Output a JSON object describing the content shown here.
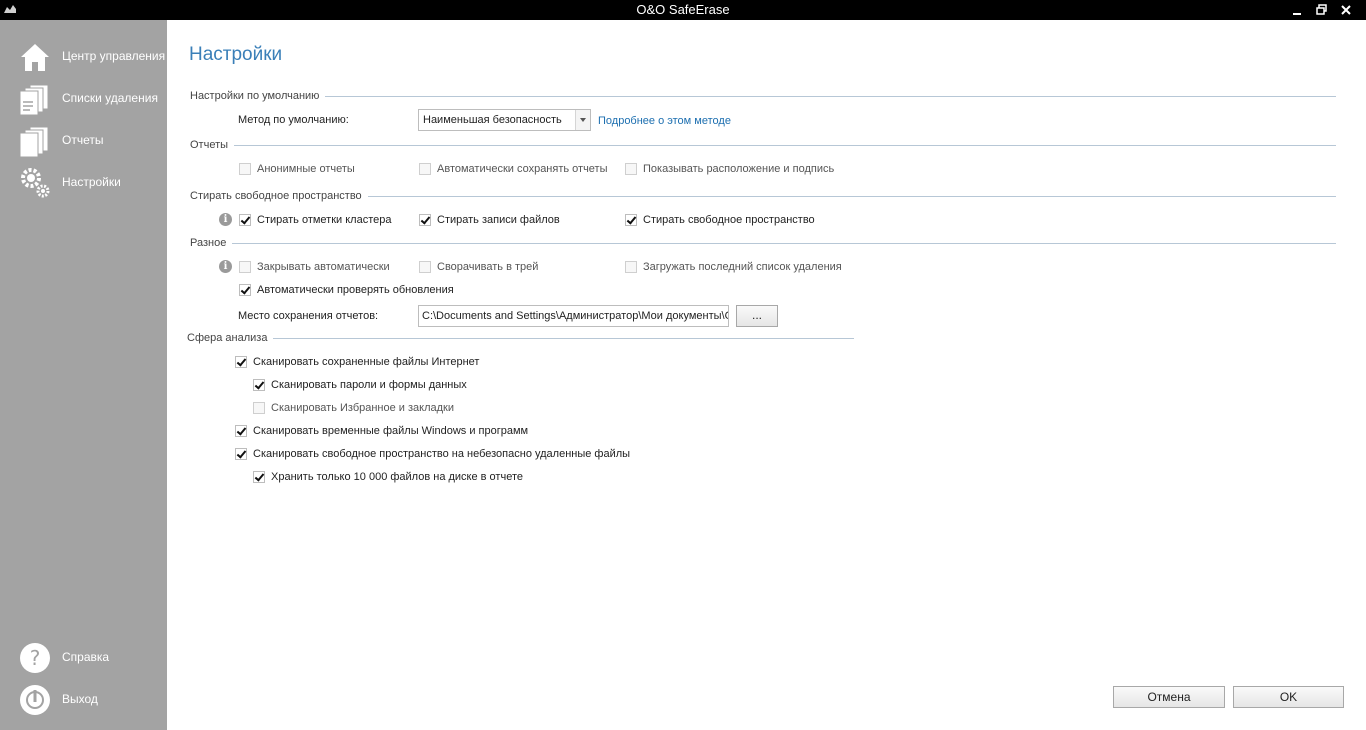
{
  "window": {
    "title": "O&O SafeErase"
  },
  "sidebar": {
    "items": [
      {
        "label": "Центр управления",
        "icon": "home-icon"
      },
      {
        "label": "Списки удаления",
        "icon": "delete-lists-icon"
      },
      {
        "label": "Отчеты",
        "icon": "reports-icon"
      },
      {
        "label": "Настройки",
        "icon": "settings-gears-icon"
      }
    ],
    "bottom_items": [
      {
        "label": "Справка",
        "icon": "help-icon"
      },
      {
        "label": "Выход",
        "icon": "power-icon"
      }
    ]
  },
  "page": {
    "title": "Настройки"
  },
  "sections": {
    "defaults": {
      "title": "Настройки по умолчанию",
      "method_label": "Метод по умолчанию:",
      "method_value": "Наименьшая безопасность",
      "method_link": "Подробнее о этом методе"
    },
    "reports": {
      "title": "Отчеты",
      "anonymous": {
        "label": "Анонимные отчеты",
        "checked": false
      },
      "autosave": {
        "label": "Автоматически сохранять отчеты",
        "checked": false
      },
      "show_location": {
        "label": "Показывать расположение и подпись",
        "checked": false
      }
    },
    "free_space": {
      "title": "Стирать свободное пространство",
      "cluster_tips": {
        "label": "Стирать отметки кластера",
        "checked": true
      },
      "file_records": {
        "label": "Стирать записи файлов",
        "checked": true
      },
      "free_space": {
        "label": "Стирать свободное пространство",
        "checked": true
      }
    },
    "misc": {
      "title": "Разное",
      "auto_close": {
        "label": "Закрывать автоматически",
        "checked": false
      },
      "minimize_tray": {
        "label": "Сворачивать в трей",
        "checked": false
      },
      "load_last": {
        "label": "Загружать последний список удаления",
        "checked": false
      },
      "auto_update": {
        "label": "Автоматически проверять обновления",
        "checked": true
      },
      "report_path_label": "Место сохранения отчетов:",
      "report_path_value": "C:\\Documents and Settings\\Администратор\\Мои документы\\O",
      "browse_label": "..."
    },
    "scan": {
      "title": "Сфера анализа",
      "internet": {
        "label": "Сканировать сохраненные файлы Интернет",
        "checked": true
      },
      "passwords": {
        "label": "Сканировать пароли и формы данных",
        "checked": true
      },
      "favorites": {
        "label": "Сканировать Избранное и закладки",
        "checked": false
      },
      "temp": {
        "label": "Сканировать временные файлы Windows и программ",
        "checked": true
      },
      "unsafe": {
        "label": "Сканировать свободное пространство на небезопасно удаленные файлы",
        "checked": true
      },
      "limit": {
        "label": "Хранить только 10 000 файлов на диске в отчете",
        "checked": true
      }
    }
  },
  "footer": {
    "cancel_label": "Отмена",
    "ok_label": "OK"
  }
}
